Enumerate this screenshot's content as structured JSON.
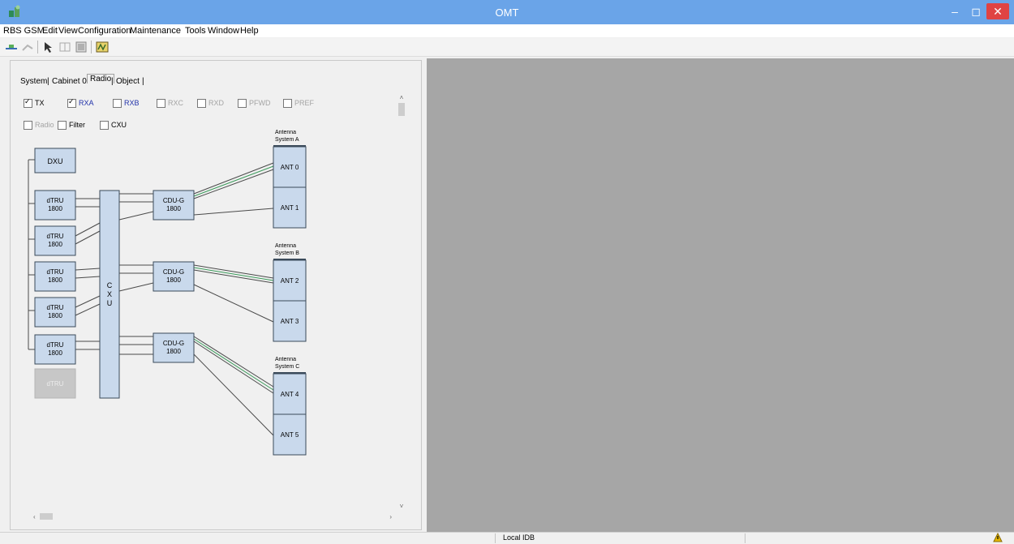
{
  "window": {
    "title": "OMT"
  },
  "menu": [
    "RBS GSM",
    "Edit",
    "View",
    "Configuration",
    "Maintenance",
    "Tools",
    "Window",
    "Help"
  ],
  "tabs": [
    "System",
    "Cabinet 0",
    "Radio",
    "Object"
  ],
  "active_tab": "Radio",
  "filters_row1": [
    {
      "label": "TX",
      "checked": true,
      "style": "normal"
    },
    {
      "label": "RXA",
      "checked": true,
      "style": "blue"
    },
    {
      "label": "RXB",
      "checked": false,
      "style": "blue"
    },
    {
      "label": "RXC",
      "checked": false,
      "style": "dim"
    },
    {
      "label": "RXD",
      "checked": false,
      "style": "dim"
    },
    {
      "label": "PFWD",
      "checked": false,
      "style": "dim"
    },
    {
      "label": "PREF",
      "checked": false,
      "style": "dim"
    }
  ],
  "filters_row2": [
    {
      "label": "Radio",
      "checked": false,
      "style": "dim"
    },
    {
      "label": "Filter",
      "checked": false,
      "style": "normal"
    },
    {
      "label": "CXU",
      "checked": false,
      "style": "normal"
    }
  ],
  "diagram": {
    "dxu_label": "DXU",
    "trx_label": "dTRU",
    "trx_band": "1800",
    "trx_units": 5,
    "cxu_label": "C\nX\nU",
    "combiner_label": "CDU-G",
    "combiner_band": "1800",
    "antenna_systems": [
      {
        "title": "Antenna System A",
        "antennas": [
          "ANT 0",
          "ANT 1"
        ]
      },
      {
        "title": "Antenna System B",
        "antennas": [
          "ANT 2",
          "ANT 3"
        ]
      },
      {
        "title": "Antenna System C",
        "antennas": [
          "ANT 4",
          "ANT 5"
        ]
      }
    ]
  },
  "status": {
    "text": "Local IDB"
  },
  "colors": {
    "titlebar": "#6aa4e8",
    "close": "#e04343",
    "block_fill": "#c9d9ec",
    "block_stroke": "#3a4a5a",
    "viewer": "#a6a6a6",
    "link_green": "#3a9a5a"
  },
  "icons": [
    "app-icon",
    "connect-icon",
    "disconnect-icon",
    "pointer-icon",
    "grid-icon",
    "view-icon",
    "radio-config-icon",
    "warning-icon"
  ]
}
